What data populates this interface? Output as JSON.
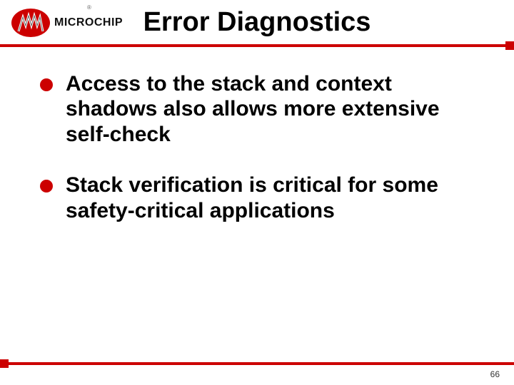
{
  "header": {
    "logo_text": "MICROCHIP",
    "reg_mark": "®",
    "title": "Error Diagnostics"
  },
  "bullets": [
    "Access to the stack and context shadows also allows more extensive self-check",
    "Stack verification is critical for some safety-critical applications"
  ],
  "footer": {
    "page_number": "66"
  }
}
